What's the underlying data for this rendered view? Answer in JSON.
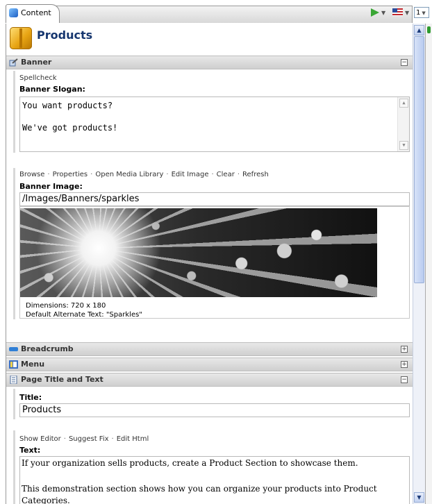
{
  "tab": {
    "label": "Content",
    "page_number": "1"
  },
  "page": {
    "title": "Products"
  },
  "banner": {
    "section_label": "Banner",
    "spellcheck": "Spellcheck",
    "slogan_label": "Banner Slogan:",
    "slogan_line1": "You want products?",
    "slogan_line2": "We've got products!",
    "image_tools": [
      "Browse",
      "Properties",
      "Open Media Library",
      "Edit Image",
      "Clear",
      "Refresh"
    ],
    "image_label": "Banner Image:",
    "image_path": "/Images/Banners/sparkles",
    "dimensions": "Dimensions: 720 x 180",
    "alt_text": "Default Alternate Text: \"Sparkles\""
  },
  "sections": {
    "breadcrumb": "Breadcrumb",
    "menu": "Menu",
    "page_title_text": "Page Title and Text"
  },
  "title_field": {
    "label": "Title:",
    "value": "Products"
  },
  "text_field": {
    "tools": [
      "Show Editor",
      "Suggest Fix",
      "Edit Html"
    ],
    "label": "Text:",
    "para1": "If your organization sells products, create a Product Section to showcase them.",
    "para2": "This demonstration section shows how you can organize your products into Product",
    "para2_cont": "Categories."
  },
  "colors": {
    "title": "#16366f",
    "section_bar": "#d8d8d8",
    "scrollbar": "#c3d2f1"
  },
  "icons": [
    "content-cube-icon",
    "run-icon",
    "flag-icon",
    "products-box-icon",
    "banner-icon",
    "breadcrumb-icon",
    "menu-icon",
    "page-icon"
  ]
}
